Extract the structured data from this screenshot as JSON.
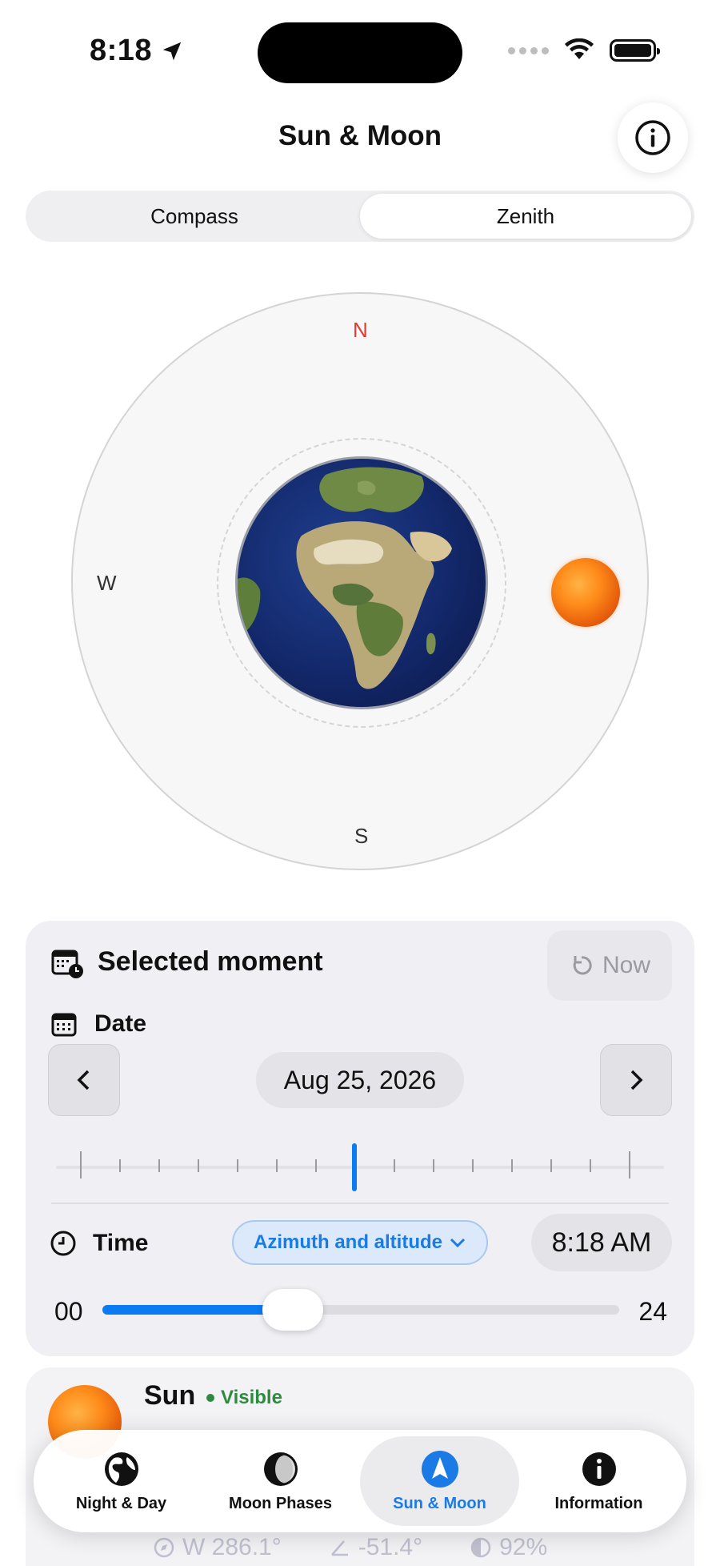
{
  "status_bar": {
    "time": "8:18"
  },
  "header": {
    "title": "Sun & Moon"
  },
  "segmented": {
    "items": [
      {
        "label": "Compass"
      },
      {
        "label": "Zenith"
      }
    ],
    "active": "Zenith"
  },
  "compass": {
    "north": "N",
    "south": "S",
    "west": "W"
  },
  "moment": {
    "title": "Selected moment",
    "now_label": "Now",
    "date_label": "Date",
    "date_value": "Aug 25, 2026",
    "time_label": "Time",
    "mode_label": "Azimuth and altitude",
    "time_value": "8:18 AM",
    "slider_min": "00",
    "slider_max": "24",
    "slider_fraction": 0.368
  },
  "sun": {
    "name": "Sun",
    "status": "Visible",
    "azimuth": "W 286.1°",
    "altitude": "-51.4°",
    "percent": "92%"
  },
  "tabs": [
    {
      "label": "Night & Day",
      "icon": "globe-icon"
    },
    {
      "label": "Moon Phases",
      "icon": "moon-phase-icon"
    },
    {
      "label": "Sun & Moon",
      "icon": "navigation-arrow-icon"
    },
    {
      "label": "Information",
      "icon": "info-icon"
    }
  ],
  "colors": {
    "accent": "#1a7be6",
    "north": "#e53935",
    "visible": "#2d8a3e"
  }
}
